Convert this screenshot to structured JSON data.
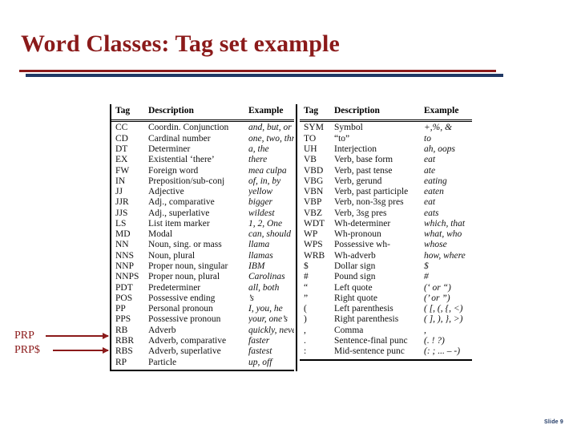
{
  "slide": {
    "title": "Word Classes: Tag set example",
    "slide_number_label": "Slide 9",
    "accent_red": "#8B1A1A",
    "accent_navy": "#1F3864"
  },
  "annotations": [
    {
      "label": "PRP",
      "points_to": "PP"
    },
    {
      "label": "PRP$",
      "points_to": "PPS"
    }
  ],
  "table": {
    "headers": {
      "tag": "Tag",
      "description": "Description",
      "example": "Example"
    },
    "left_rows": [
      {
        "tag": "CC",
        "description": "Coordin. Conjunction",
        "example": "and, but, or"
      },
      {
        "tag": "CD",
        "description": "Cardinal number",
        "example": "one, two, three"
      },
      {
        "tag": "DT",
        "description": "Determiner",
        "example": "a, the"
      },
      {
        "tag": "EX",
        "description": "Existential ‘there’",
        "example": "there"
      },
      {
        "tag": "FW",
        "description": "Foreign word",
        "example": "mea culpa"
      },
      {
        "tag": "IN",
        "description": "Preposition/sub-conj",
        "example": "of, in, by"
      },
      {
        "tag": "JJ",
        "description": "Adjective",
        "example": "yellow"
      },
      {
        "tag": "JJR",
        "description": "Adj., comparative",
        "example": "bigger"
      },
      {
        "tag": "JJS",
        "description": "Adj., superlative",
        "example": "wildest"
      },
      {
        "tag": "LS",
        "description": "List item marker",
        "example": "1, 2, One"
      },
      {
        "tag": "MD",
        "description": "Modal",
        "example": "can, should"
      },
      {
        "tag": "NN",
        "description": "Noun, sing. or mass",
        "example": "llama"
      },
      {
        "tag": "NNS",
        "description": "Noun, plural",
        "example": "llamas"
      },
      {
        "tag": "NNP",
        "description": "Proper noun, singular",
        "example": "IBM"
      },
      {
        "tag": "NNPS",
        "description": "Proper noun, plural",
        "example": "Carolinas"
      },
      {
        "tag": "PDT",
        "description": "Predeterminer",
        "example": "all, both"
      },
      {
        "tag": "POS",
        "description": "Possessive ending",
        "example": "’s"
      },
      {
        "tag": "PP",
        "description": "Personal pronoun",
        "example": "I, you, he"
      },
      {
        "tag": "PPS",
        "description": "Possessive pronoun",
        "example": "your, one’s"
      },
      {
        "tag": "RB",
        "description": "Adverb",
        "example": "quickly, never"
      },
      {
        "tag": "RBR",
        "description": "Adverb, comparative",
        "example": "faster"
      },
      {
        "tag": "RBS",
        "description": "Adverb, superlative",
        "example": "fastest"
      },
      {
        "tag": "RP",
        "description": "Particle",
        "example": "up, off"
      }
    ],
    "right_rows": [
      {
        "tag": "SYM",
        "description": "Symbol",
        "example": "+,%, &"
      },
      {
        "tag": "TO",
        "description": "“to”",
        "example": "to"
      },
      {
        "tag": "UH",
        "description": "Interjection",
        "example": "ah, oops"
      },
      {
        "tag": "VB",
        "description": "Verb, base form",
        "example": "eat"
      },
      {
        "tag": "VBD",
        "description": "Verb, past tense",
        "example": "ate"
      },
      {
        "tag": "VBG",
        "description": "Verb, gerund",
        "example": "eating"
      },
      {
        "tag": "VBN",
        "description": "Verb, past participle",
        "example": "eaten"
      },
      {
        "tag": "VBP",
        "description": "Verb, non-3sg pres",
        "example": "eat"
      },
      {
        "tag": "VBZ",
        "description": "Verb, 3sg pres",
        "example": "eats"
      },
      {
        "tag": "WDT",
        "description": "Wh-determiner",
        "example": "which, that"
      },
      {
        "tag": "WP",
        "description": "Wh-pronoun",
        "example": "what, who"
      },
      {
        "tag": "WPS",
        "description": "Possessive wh-",
        "example": "whose"
      },
      {
        "tag": "WRB",
        "description": "Wh-adverb",
        "example": "how, where"
      },
      {
        "tag": "$",
        "description": "Dollar sign",
        "example": "$"
      },
      {
        "tag": "#",
        "description": "Pound sign",
        "example": "#"
      },
      {
        "tag": "“",
        "description": "Left quote",
        "example": "(‘ or “)"
      },
      {
        "tag": "”",
        "description": "Right quote",
        "example": "(’ or ”)"
      },
      {
        "tag": "(",
        "description": "Left parenthesis",
        "example": "( [, (, {, <)"
      },
      {
        "tag": ")",
        "description": "Right parenthesis",
        "example": "( ], ), }, >)"
      },
      {
        "tag": ",",
        "description": "Comma",
        "example": ","
      },
      {
        "tag": ".",
        "description": "Sentence-final punc",
        "example": "(. ! ?)"
      },
      {
        "tag": ":",
        "description": "Mid-sentence punc",
        "example": "(: ; ... – -)"
      }
    ]
  }
}
